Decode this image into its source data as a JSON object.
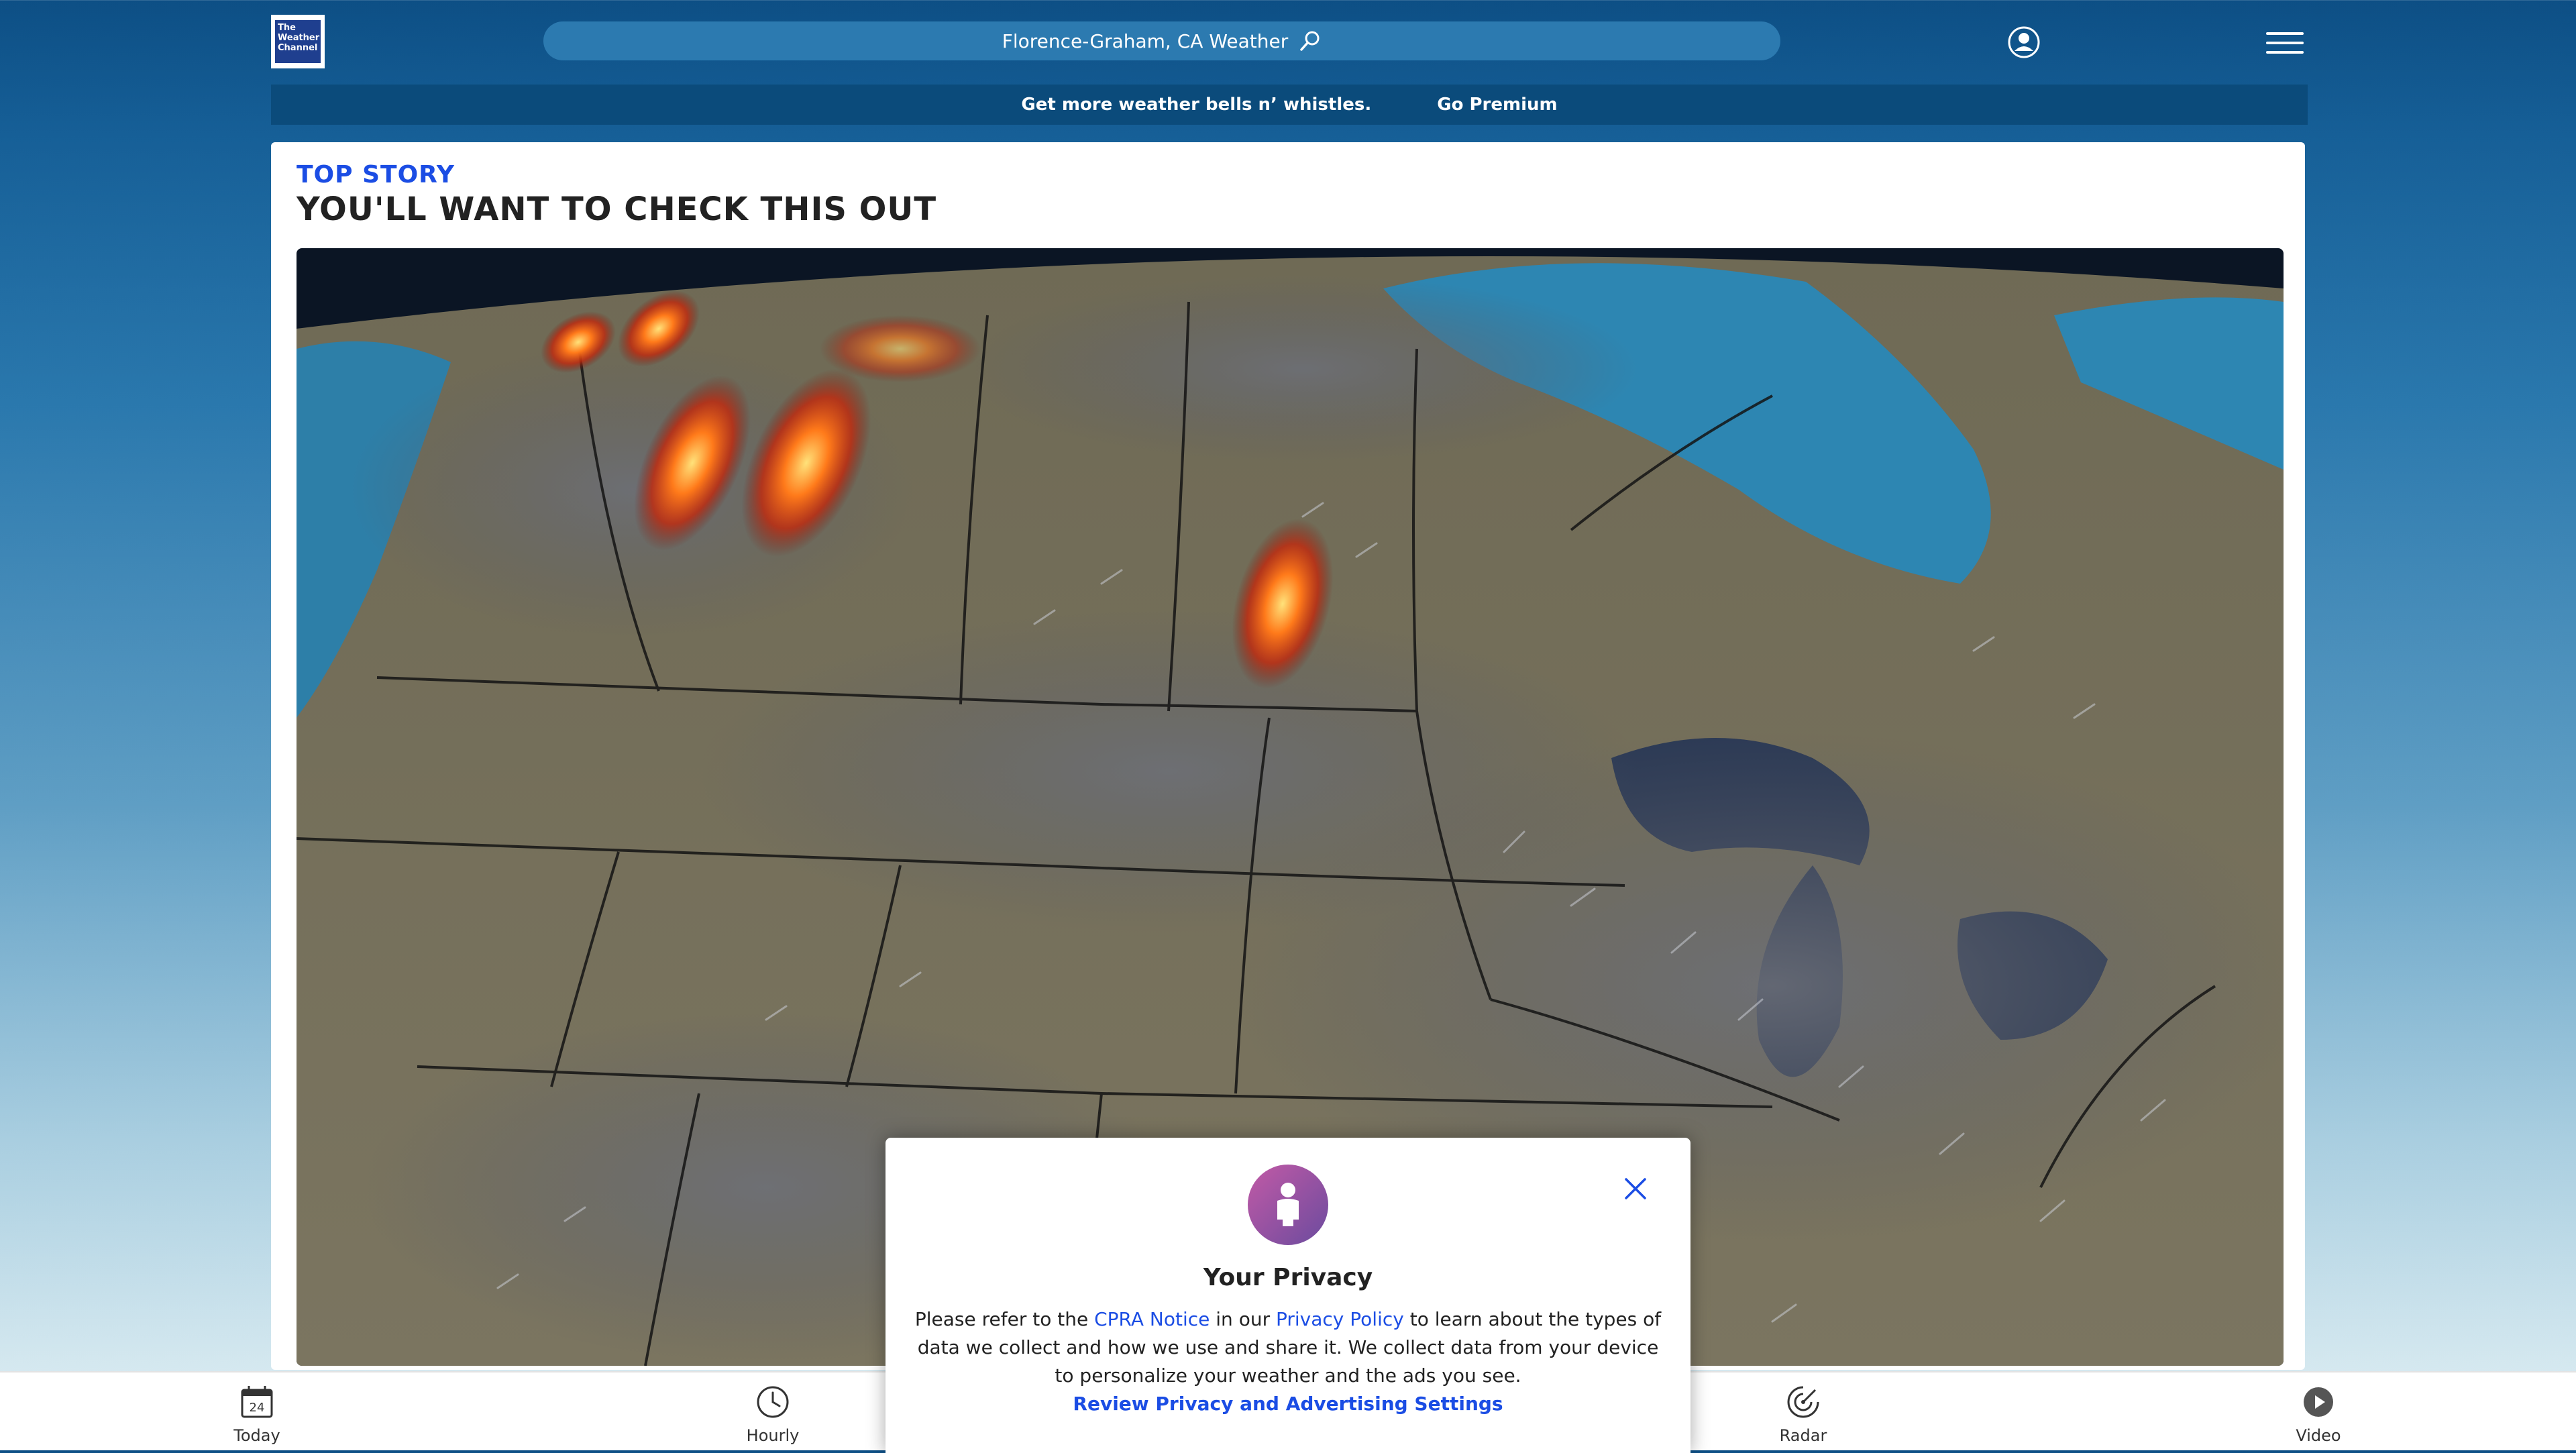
{
  "header": {
    "logo_text": "The Weather Channel",
    "search_text": "Florence-Graham, CA Weather"
  },
  "promo": {
    "message": "Get more weather bells n’ whistles.",
    "cta": "Go Premium"
  },
  "story": {
    "kicker": "TOP STORY",
    "headline": "YOU'LL WANT TO CHECK THIS OUT"
  },
  "bottom_nav": {
    "items": [
      {
        "label": "Today",
        "icon": "calendar-icon",
        "badge": "24"
      },
      {
        "label": "Hourly",
        "icon": "clock-icon"
      },
      {
        "label": "Radar",
        "icon": "radar-icon"
      },
      {
        "label": "Video",
        "icon": "play-icon"
      }
    ]
  },
  "privacy": {
    "title": "Your Privacy",
    "text_1": "Please refer to the ",
    "link_cpra": "CPRA Notice",
    "text_2": " in our ",
    "link_policy": "Privacy Policy",
    "text_3": " to learn about the types of data we collect and how we use and share it. We collect data from your device to personalize your weather and the ads you see.",
    "review_link": "Review Privacy and Advertising Settings"
  },
  "colors": {
    "header_bg": "#0d4f85",
    "accent_blue": "#1b4de4",
    "promo_bg": "#0b4b7b",
    "privacy_avatar": "#9b4fa3"
  }
}
